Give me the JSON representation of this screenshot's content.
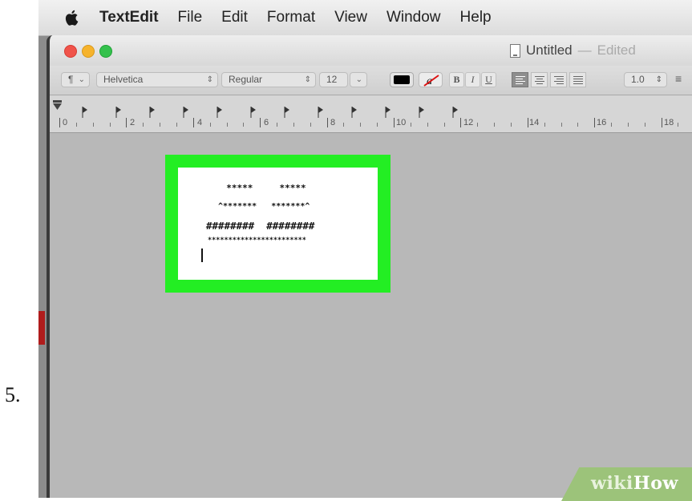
{
  "step_number": "5.",
  "menubar": {
    "app_name": "TextEdit",
    "items": [
      "File",
      "Edit",
      "Format",
      "View",
      "Window",
      "Help"
    ]
  },
  "window": {
    "title": "Untitled",
    "separator": "—",
    "status": "Edited"
  },
  "toolbar": {
    "paragraph_style": "¶",
    "font_family": "Helvetica",
    "font_style": "Regular",
    "font_size": "12",
    "bold_label": "B",
    "italic_label": "I",
    "underline_label": "U",
    "line_spacing": "1.0",
    "text_color": "#000000"
  },
  "ruler": {
    "labels": [
      "0",
      "2",
      "4",
      "6",
      "8",
      "10",
      "12",
      "14",
      "16",
      "18"
    ]
  },
  "document": {
    "lines": [
      "  *****     *****",
      " ^*******   *******^",
      "########  ########",
      "************************"
    ]
  },
  "highlight_color": "#23ee23",
  "watermark": {
    "wiki": "wiki",
    "how": "How"
  }
}
